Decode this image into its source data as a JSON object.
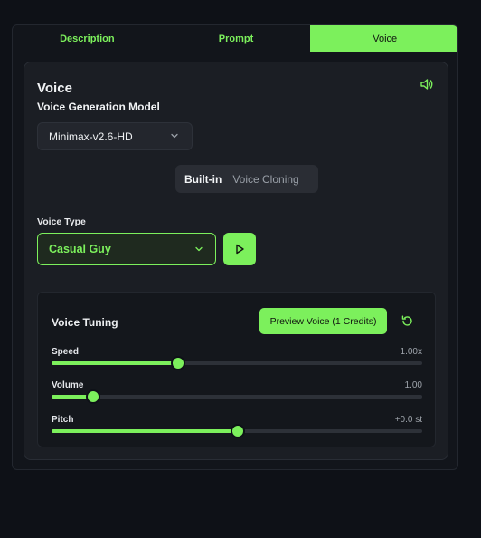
{
  "tabs": [
    {
      "label": "Description",
      "active": false
    },
    {
      "label": "Prompt",
      "active": false
    },
    {
      "label": "Voice",
      "active": true
    }
  ],
  "voice": {
    "title": "Voice",
    "model_label": "Voice Generation Model",
    "model_value": "Minimax-v2.6-HD",
    "mode_options": [
      "Built-in",
      "Voice Cloning"
    ],
    "mode_selected": "Built-in",
    "voice_type_label": "Voice Type",
    "voice_type_value": "Casual Guy",
    "speaker_icon": "speaker-icon",
    "play_icon": "play-icon"
  },
  "tuning": {
    "title": "Voice Tuning",
    "preview_label": "Preview Voice (1 Credits)",
    "reset_icon": "reset-icon",
    "sliders": [
      {
        "label": "Speed",
        "value": "1.00x",
        "level": 0.34
      },
      {
        "label": "Volume",
        "value": "1.00",
        "level": 0.11
      },
      {
        "label": "Pitch",
        "value": "+0.0 st",
        "level": 0.5
      }
    ]
  },
  "colors": {
    "accent": "#7cf05c",
    "background": "#0e1117",
    "card": "#1b1e24"
  }
}
